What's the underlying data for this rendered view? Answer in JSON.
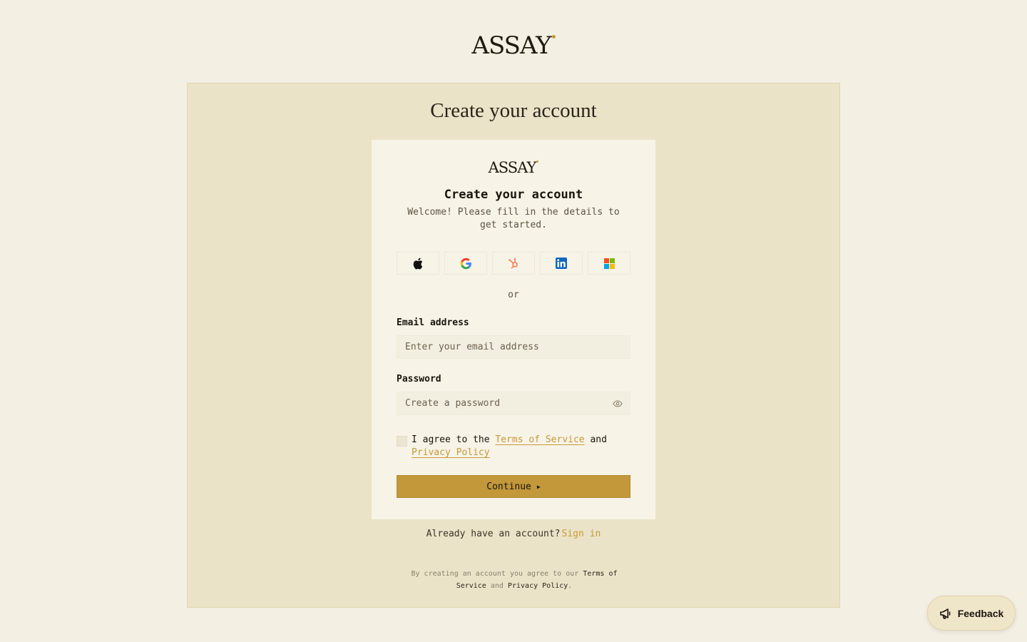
{
  "brand": {
    "name": "ASSAY",
    "accent": "#c69a3a"
  },
  "outer": {
    "title": "Create your account"
  },
  "card": {
    "title": "Create your account",
    "subtitle": "Welcome! Please fill in the details to get started.",
    "social": [
      {
        "name": "apple",
        "icon": "apple-icon"
      },
      {
        "name": "google",
        "icon": "google-icon"
      },
      {
        "name": "hubspot",
        "icon": "hubspot-icon"
      },
      {
        "name": "linkedin",
        "icon": "linkedin-icon"
      },
      {
        "name": "microsoft",
        "icon": "microsoft-icon"
      }
    ],
    "divider": "or",
    "email": {
      "label": "Email address",
      "placeholder": "Enter your email address",
      "value": ""
    },
    "password": {
      "label": "Password",
      "placeholder": "Create a password",
      "value": ""
    },
    "agree": {
      "prefix": "I agree to the",
      "terms": "Terms of Service",
      "and": "and",
      "privacy": "Privacy Policy",
      "checked": false
    },
    "continue_label": "Continue"
  },
  "signin": {
    "prompt": "Already have an account?",
    "link": "Sign in"
  },
  "legal": {
    "prefix": "By creating an account you agree to our",
    "terms": "Terms of Service",
    "and": "and",
    "privacy": "Privacy Policy",
    "end": "."
  },
  "feedback": {
    "label": "Feedback"
  }
}
